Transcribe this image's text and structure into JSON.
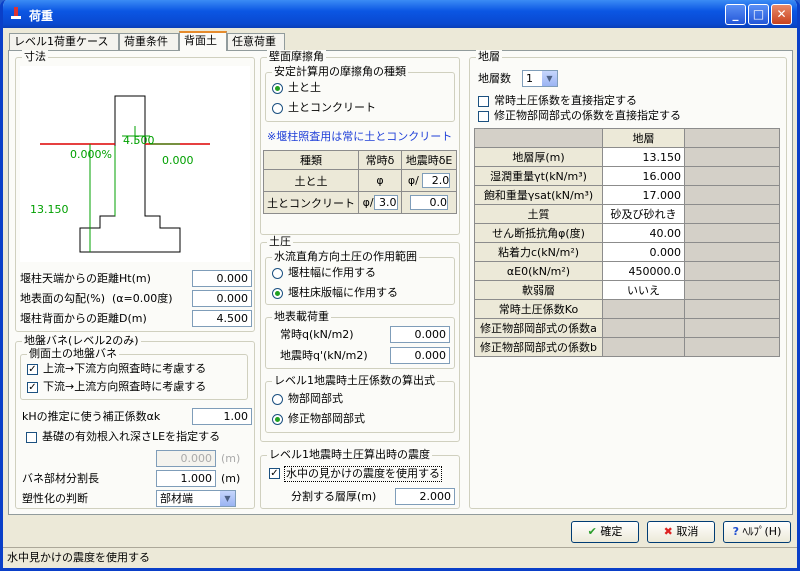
{
  "window": {
    "title": "荷重"
  },
  "tabs": [
    "レベル1荷重ケース",
    "荷重条件",
    "背面土",
    "任意荷重"
  ],
  "dims": {
    "title": "寸法",
    "fig_dim_top": "4.500",
    "fig_slope_left": "0.000%",
    "fig_slope_right": "0.000",
    "fig_height": "13.150",
    "ht_label": "堰柱天端からの距離Ht(m)",
    "ht_value": "0.000",
    "slope_label": "地表面の勾配(%)",
    "slope_note": "(α=0.00度)",
    "slope_value": "0.000",
    "d_label": "堰柱背面からの距離D(m)",
    "d_value": "4.500"
  },
  "spring": {
    "title": "地盤バネ(レベル2のみ)",
    "side_title": "側面土の地盤バネ",
    "chk1_label": "上流→下流方向照査時に考慮する",
    "chk2_label": "下流→上流方向照査時に考慮する",
    "kh_label": "kHの推定に使う補正係数αk",
    "kh_value": "1.00",
    "embed_label": "基礎の有効根入れ深さLEを指定する",
    "embed_value": "0.000",
    "embed_unit": "(m)",
    "split_label": "バネ部材分割長",
    "split_value": "1.000",
    "split_unit": "(m)",
    "plastic_label": "塑性化の判断",
    "plastic_value": "部材端"
  },
  "friction": {
    "title": "壁面摩擦角",
    "type_title": "安定計算用の摩擦角の種類",
    "opt1": "土と土",
    "opt2": "土とコンクリート",
    "note": "※堰柱照査用は常に土とコンクリート",
    "col_type": "種類",
    "col_normal": "常時δ",
    "col_quake": "地震時δE",
    "row1_name": "土と土",
    "row1_normal": "φ",
    "row1_quake_prefix": "φ/",
    "row1_quake_value": "2.0",
    "row2_name": "土とコンクリート",
    "row2_normal_prefix": "φ/",
    "row2_normal_value": "3.0",
    "row2_quake_value": "0.0"
  },
  "earth_pressure": {
    "title": "土圧",
    "range_title": "水流直角方向土圧の作用範囲",
    "opt1": "堰柱幅に作用する",
    "opt2": "堰柱床版幅に作用する",
    "surcharge_title": "地表載荷重",
    "normal_label": "常時q(kN/m2)",
    "normal_value": "0.000",
    "quake_label": "地震時q'(kN/m2)",
    "quake_value": "0.000",
    "method_title": "レベル1地震時土圧係数の算出式",
    "method_opt1": "物部岡部式",
    "method_opt2": "修正物部岡部式"
  },
  "seismic": {
    "title": "レベル1地震時土圧算出時の震度",
    "chk_label": "水中の見かけの震度を使用する",
    "layer_label": "分割する層厚(m)",
    "layer_value": "2.000"
  },
  "strata": {
    "title": "地層",
    "count_label": "地層数",
    "count_value": "1",
    "chk1_label": "常時土圧係数を直接指定する",
    "chk2_label": "修正物部岡部式の係数を直接指定する",
    "col_header": "地層",
    "rows": [
      {
        "label": "地層厚(m)",
        "value": "13.150"
      },
      {
        "label": "湿潤重量γt(kN/m³)",
        "value": "16.000"
      },
      {
        "label": "飽和重量γsat(kN/m³)",
        "value": "17.000"
      },
      {
        "label": "土質",
        "value": "砂及び砂れき"
      },
      {
        "label": "せん断抵抗角φ(度)",
        "value": "40.00"
      },
      {
        "label": "粘着力c(kN/m²)",
        "value": "0.000"
      },
      {
        "label": "αE0(kN/m²)",
        "value": "450000.0"
      },
      {
        "label": "軟弱層",
        "value": "いいえ"
      },
      {
        "label": "常時土圧係数Ko",
        "value": ""
      },
      {
        "label": "修正物部岡部式の係数a",
        "value": ""
      },
      {
        "label": "修正物部岡部式の係数b",
        "value": ""
      }
    ]
  },
  "buttons": {
    "ok": "確定",
    "cancel": "取消",
    "help": "ﾍﾙﾌﾟ(H)"
  },
  "status": "水中見かけの震度を使用する"
}
